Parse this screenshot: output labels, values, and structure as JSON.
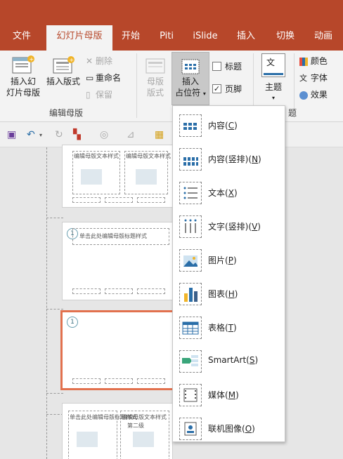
{
  "tabs": [
    "文件",
    "幻灯片母版",
    "开始",
    "Piti",
    "iSlide",
    "插入",
    "切换",
    "动画"
  ],
  "active_tab_index": 1,
  "ribbon": {
    "insert_slide_master": [
      "插入幻",
      "灯片母版"
    ],
    "insert_layout": [
      "插入版式"
    ],
    "delete": "删除",
    "rename": "重命名",
    "preserve": "保留",
    "edit_master_group": "编辑母版",
    "master_layout": [
      "母版",
      "版式"
    ],
    "insert_placeholder": [
      "插入",
      "占位符"
    ],
    "title_checkbox": "标题",
    "footer_checkbox": "页脚",
    "theme": "主题",
    "colors": "颜色",
    "fonts": "字体",
    "effects": "效果",
    "theme_icon_text": "文",
    "partial_group_label": "题"
  },
  "qat": {
    "save": "save-icon",
    "undo": "undo-icon",
    "redo": "redo-icon"
  },
  "slides": {
    "thumb1_title": "编辑母版文本样式",
    "thumb1_body": "单击此处编辑母版标题样式",
    "thumb2_title": "单击此处编辑母版标题样式",
    "thumb2_badge": "1",
    "thumb3_badge": "1",
    "thumb4_left": "单击此处编辑母版标题样式",
    "thumb4_right": "编辑母版文本样式",
    "thumb4_sub": "第二级"
  },
  "placeholder_menu": [
    {
      "label": "内容",
      "key": "C",
      "icon": "content-icon"
    },
    {
      "label": "内容(竖排)",
      "key": "N",
      "icon": "content-vertical-icon"
    },
    {
      "label": "文本",
      "key": "X",
      "icon": "text-icon"
    },
    {
      "label": "文字(竖排)",
      "key": "V",
      "icon": "text-vertical-icon"
    },
    {
      "label": "图片",
      "key": "P",
      "icon": "picture-icon"
    },
    {
      "label": "图表",
      "key": "H",
      "icon": "chart-icon"
    },
    {
      "label": "表格",
      "key": "T",
      "icon": "table-icon"
    },
    {
      "label": "SmartArt",
      "key": "S",
      "icon": "smartart-icon"
    },
    {
      "label": "媒体",
      "key": "M",
      "icon": "media-icon"
    },
    {
      "label": "联机图像",
      "key": "O",
      "icon": "online-picture-icon"
    }
  ]
}
